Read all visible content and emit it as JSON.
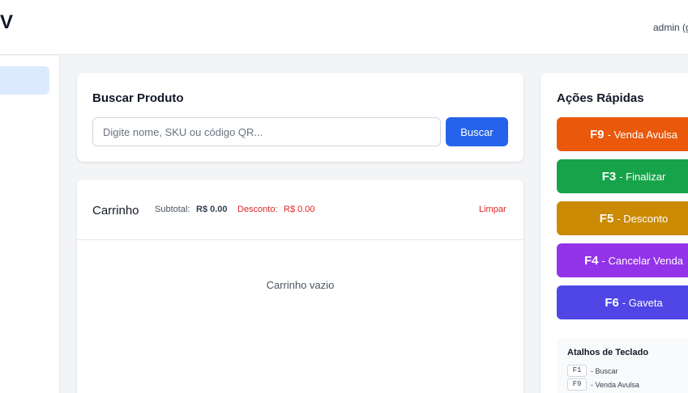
{
  "header": {
    "brand": "V",
    "user": "admin (g"
  },
  "search": {
    "title": "Buscar Produto",
    "placeholder": "Digite nome, SKU ou código QR...",
    "button_label": "Buscar"
  },
  "cart": {
    "title": "Carrinho",
    "subtotal_label": "Subtotal:",
    "subtotal_value": "R$ 0.00",
    "discount_label": "Desconto:",
    "discount_value": "R$ 0.00",
    "clear_label": "Limpar",
    "empty_text": "Carrinho vazio"
  },
  "actions": {
    "title": "Ações Rápidas",
    "buttons": [
      {
        "key": "F9",
        "label": "- Venda Avulsa",
        "color": "#ea580c"
      },
      {
        "key": "F3",
        "label": "- Finalizar",
        "color": "#16a34a"
      },
      {
        "key": "F5",
        "label": "- Desconto",
        "color": "#ca8a04"
      },
      {
        "key": "F4",
        "label": "- Cancelar Venda",
        "color": "#9333ea"
      },
      {
        "key": "F6",
        "label": "- Gaveta",
        "color": "#4f46e5"
      }
    ]
  },
  "shortcuts": {
    "title": "Atalhos de Teclado",
    "items": [
      {
        "key": "F1",
        "label": "- Buscar"
      },
      {
        "key": "F9",
        "label": "- Venda Avulsa"
      }
    ]
  },
  "colors": {
    "primary": "#2563eb",
    "danger": "#dc2626",
    "sidebar_active": "#dbeafe"
  }
}
